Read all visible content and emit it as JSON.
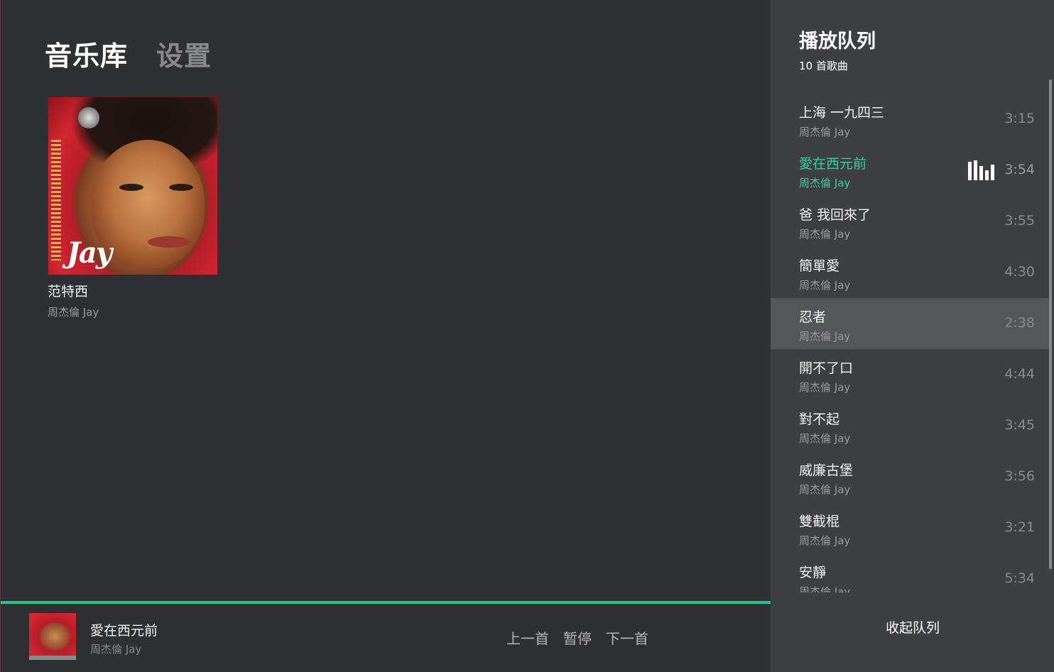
{
  "nav": {
    "tabs": [
      {
        "label": "音乐库",
        "active": true
      },
      {
        "label": "设置",
        "active": false
      }
    ]
  },
  "library": {
    "albums": [
      {
        "title": "范特西",
        "artist": "周杰倫 Jay",
        "cover_text": "Jay"
      }
    ]
  },
  "player": {
    "progress_fraction": 1.0,
    "now_playing": {
      "title": "愛在西元前",
      "artist": "周杰倫 Jay"
    },
    "controls": {
      "prev": "上一首",
      "pause": "暂停",
      "next": "下一首"
    }
  },
  "queue": {
    "title": "播放队列",
    "count": "10 首歌曲",
    "collapse_label": "收起队列",
    "items": [
      {
        "title": "上海 一九四三",
        "artist": "周杰倫 Jay",
        "duration": "3:15",
        "state": "normal"
      },
      {
        "title": "愛在西元前",
        "artist": "周杰倫 Jay",
        "duration": "3:54",
        "state": "playing"
      },
      {
        "title": "爸 我回來了",
        "artist": "周杰倫 Jay",
        "duration": "3:55",
        "state": "normal"
      },
      {
        "title": "簡單愛",
        "artist": "周杰倫 Jay",
        "duration": "4:30",
        "state": "normal"
      },
      {
        "title": "忍者",
        "artist": "周杰倫 Jay",
        "duration": "2:38",
        "state": "hover"
      },
      {
        "title": "開不了口",
        "artist": "周杰倫 Jay",
        "duration": "4:44",
        "state": "normal"
      },
      {
        "title": "對不起",
        "artist": "周杰倫 Jay",
        "duration": "3:45",
        "state": "normal"
      },
      {
        "title": "威廉古堡",
        "artist": "周杰倫 Jay",
        "duration": "3:56",
        "state": "normal"
      },
      {
        "title": "雙截棍",
        "artist": "周杰倫 Jay",
        "duration": "3:21",
        "state": "normal"
      },
      {
        "title": "安靜",
        "artist": "周杰倫 Jay",
        "duration": "5:34",
        "state": "normal"
      }
    ]
  },
  "colors": {
    "accent": "#2fbe8a",
    "playing_text": "#2fd49a",
    "main_bg": "#2f3033",
    "queue_bg": "#3e3f42",
    "hover_bg": "#555658"
  },
  "icons": {
    "playing_indicator": "equalizer-bars-icon"
  }
}
